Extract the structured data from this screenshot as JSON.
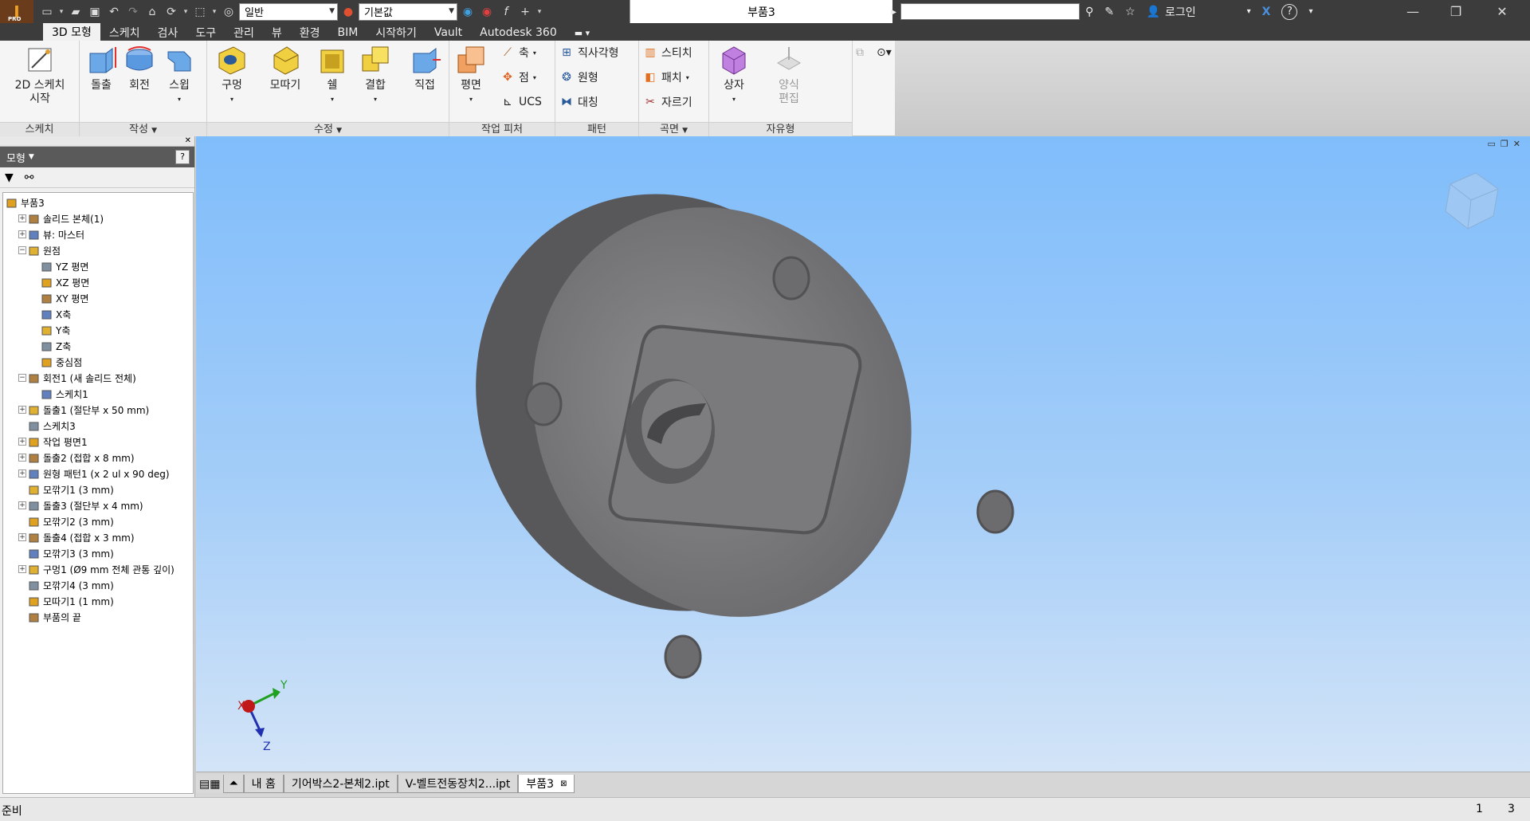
{
  "title_bar": {
    "app_badge": "PRO",
    "style_combo": "일반",
    "material_combo": "기본값",
    "document_title": "부품3",
    "login_label": "로그인"
  },
  "ribbon_tabs": [
    "3D 모형",
    "스케치",
    "검사",
    "도구",
    "관리",
    "뷰",
    "환경",
    "BIM",
    "시작하기",
    "Vault",
    "Autodesk 360"
  ],
  "ribbon": {
    "sketch_start": "2D 스케치\n시작",
    "extrude": "돌출",
    "revolve": "회전",
    "sweep": "스윕",
    "hole": "구멍",
    "fillet": "모따기",
    "shell": "쉘",
    "combine": "결합",
    "direct": "직접",
    "plane": "평면",
    "axis": "축",
    "point": "점",
    "ucs": "UCS",
    "rect_pattern": "직사각형",
    "circ_pattern": "원형",
    "mirror": "대칭",
    "stitch": "스티치",
    "patch": "패치",
    "trim": "자르기",
    "box": "상자",
    "edit_form": "양식\n편집",
    "panel_labels": {
      "sketch": "스케치",
      "create": "작성",
      "modify": "수정",
      "work_features": "작업 피처",
      "pattern": "패턴",
      "surface": "곡면",
      "freeform": "자유형"
    }
  },
  "browser": {
    "title": "모형",
    "tree": [
      {
        "label": "부품3",
        "level": 0,
        "expander": ""
      },
      {
        "label": "솔리드 본체(1)",
        "level": 1,
        "expander": "+"
      },
      {
        "label": "뷰: 마스터",
        "level": 1,
        "expander": "+"
      },
      {
        "label": "원점",
        "level": 1,
        "expander": "−"
      },
      {
        "label": "YZ 평면",
        "level": 2,
        "expander": ""
      },
      {
        "label": "XZ 평면",
        "level": 2,
        "expander": ""
      },
      {
        "label": "XY 평면",
        "level": 2,
        "expander": ""
      },
      {
        "label": "X축",
        "level": 2,
        "expander": ""
      },
      {
        "label": "Y축",
        "level": 2,
        "expander": ""
      },
      {
        "label": "Z축",
        "level": 2,
        "expander": ""
      },
      {
        "label": "중심점",
        "level": 2,
        "expander": ""
      },
      {
        "label": "회전1 (새 솔리드 전체)",
        "level": 1,
        "expander": "−"
      },
      {
        "label": "스케치1",
        "level": 2,
        "expander": ""
      },
      {
        "label": "돌출1 (절단부 x 50 mm)",
        "level": 1,
        "expander": "+"
      },
      {
        "label": "스케치3",
        "level": 1,
        "expander": ""
      },
      {
        "label": "작업 평면1",
        "level": 1,
        "expander": "+"
      },
      {
        "label": "돌출2 (접합 x 8 mm)",
        "level": 1,
        "expander": "+"
      },
      {
        "label": "원형 패턴1 (x 2 ul x 90 deg)",
        "level": 1,
        "expander": "+"
      },
      {
        "label": "모깎기1 (3 mm)",
        "level": 1,
        "expander": ""
      },
      {
        "label": "돌출3 (절단부 x 4 mm)",
        "level": 1,
        "expander": "+"
      },
      {
        "label": "모깎기2 (3 mm)",
        "level": 1,
        "expander": ""
      },
      {
        "label": "돌출4 (접합 x 3 mm)",
        "level": 1,
        "expander": "+"
      },
      {
        "label": "모깎기3 (3 mm)",
        "level": 1,
        "expander": ""
      },
      {
        "label": "구멍1 (Ø9 mm 전체 관통 깊이)",
        "level": 1,
        "expander": "+"
      },
      {
        "label": "모깎기4 (3 mm)",
        "level": 1,
        "expander": ""
      },
      {
        "label": "모따기1 (1 mm)",
        "level": 1,
        "expander": ""
      },
      {
        "label": "부품의 끝",
        "level": 1,
        "expander": ""
      }
    ]
  },
  "viewport": {
    "axis_x": "X",
    "axis_y": "Y",
    "axis_z": "Z"
  },
  "doc_tabs": [
    "내 홈",
    "기어박스2-본체2.ipt",
    "V-벨트전동장치2...ipt",
    "부품3"
  ],
  "status": {
    "text": "준비",
    "count1": "1",
    "count2": "3"
  }
}
